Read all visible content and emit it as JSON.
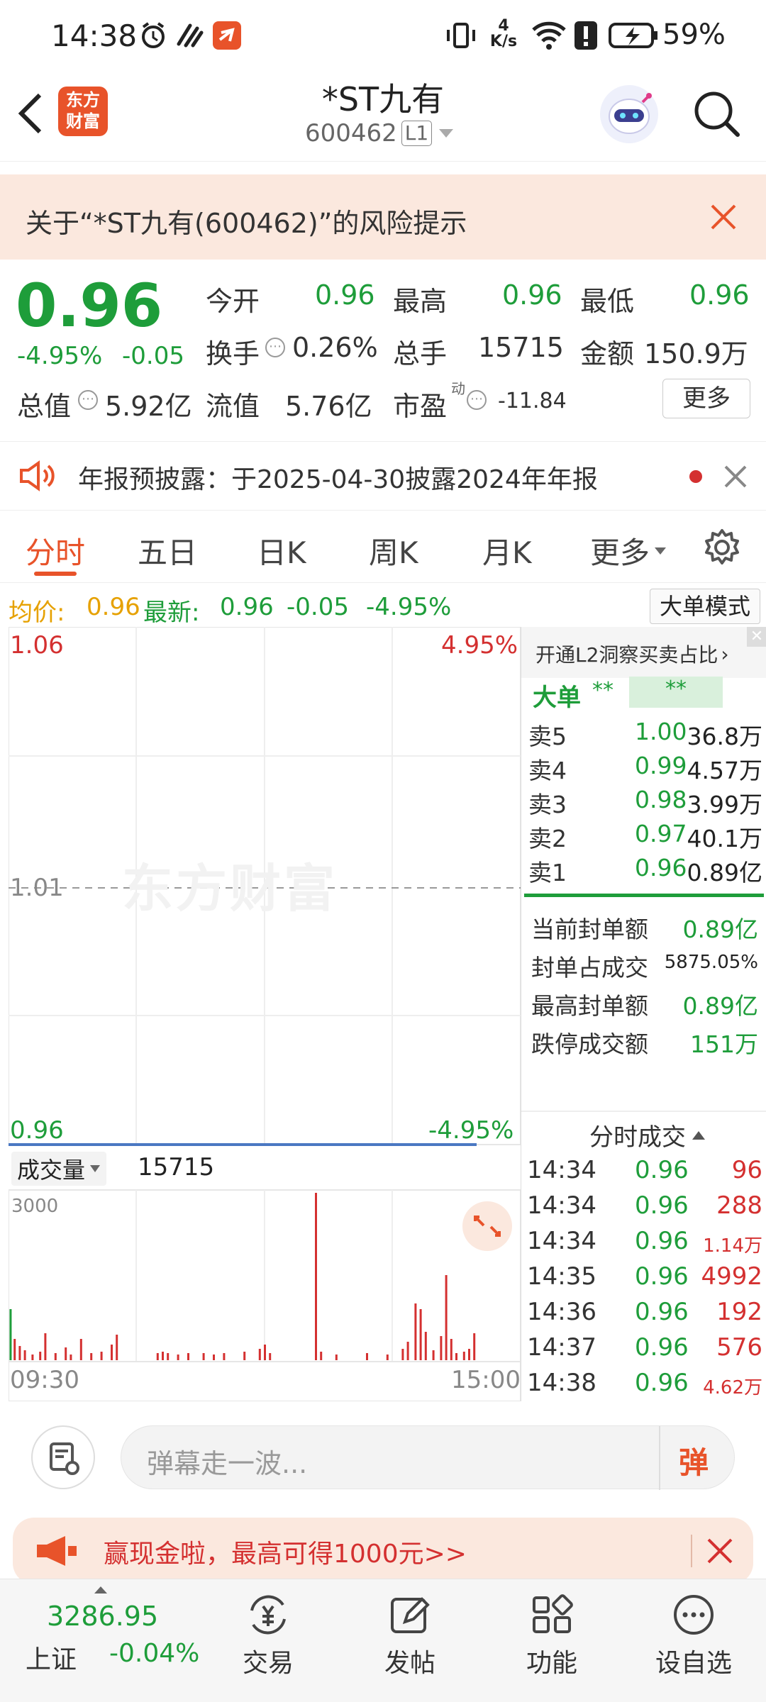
{
  "status": {
    "time": "14:38",
    "net_speed_top": "4",
    "net_speed_bottom": "K/s",
    "battery": "59%"
  },
  "header": {
    "title": "*ST九有",
    "code": "600462",
    "level": "L1",
    "logo_line1": "东方",
    "logo_line2": "财富"
  },
  "risk_banner": {
    "text": "关于“*ST九有(600462)”的风险提示"
  },
  "quote": {
    "price": "0.96",
    "change_pct": "-4.95%",
    "change": "-0.05",
    "open_label": "今开",
    "open": "0.96",
    "high_label": "最高",
    "high": "0.96",
    "low_label": "最低",
    "low": "0.96",
    "turnover_label": "换手",
    "turnover": "0.26%",
    "volume_label": "总手",
    "volume": "15715",
    "amount_label": "金额",
    "amount": "150.9万",
    "mcap_label": "总值",
    "mcap": "5.92亿",
    "float_label": "流值",
    "float": "5.76亿",
    "pe_label": "市盈",
    "pe_sup": "动",
    "pe": "-11.84",
    "more": "更多"
  },
  "notice": {
    "text": "年报预披露：于2025-04-30披露2024年年报"
  },
  "tabs": [
    "分时",
    "五日",
    "日K",
    "周K",
    "月K",
    "更多"
  ],
  "infoline": {
    "avg_label": "均价:",
    "avg": "0.96",
    "last_label": "最新:",
    "last": "0.96",
    "chg": "-0.05",
    "pct": "-4.95%",
    "mode_btn": "大单模式"
  },
  "chart": {
    "y_top": "1.06",
    "y_top_pct": "4.95%",
    "y_mid": "1.01",
    "y_bot": "0.96",
    "y_bot_pct": "-4.95%",
    "watermark": "东方财富",
    "volume_label": "成交量",
    "volume_value": "15715",
    "vol_axis": "3000",
    "t_start": "09:30",
    "t_end": "15:00"
  },
  "chart_data": {
    "type": "bar",
    "title": "",
    "xlabel": "",
    "ylabel": "",
    "x_range": [
      "09:30",
      "15:00"
    ],
    "ylim": [
      0,
      3000
    ]
  },
  "rpanel": {
    "l2_link": "开通L2洞察买卖占比",
    "big_label": "大单",
    "big_v1": "**",
    "big_v2": "**",
    "asks": [
      {
        "label": "卖5",
        "price": "1.00",
        "vol": "36.8万"
      },
      {
        "label": "卖4",
        "price": "0.99",
        "vol": "4.57万"
      },
      {
        "label": "卖3",
        "price": "0.98",
        "vol": "3.99万"
      },
      {
        "label": "卖2",
        "price": "0.97",
        "vol": "40.1万"
      },
      {
        "label": "卖1",
        "price": "0.96",
        "vol": "0.89亿"
      }
    ],
    "seal": [
      {
        "label": "当前封单额",
        "value": "0.89亿"
      },
      {
        "label": "封单占成交",
        "value": "5875.05%"
      },
      {
        "label": "最高封单额",
        "value": "0.89亿"
      },
      {
        "label": "跌停成交额",
        "value": "151万"
      }
    ],
    "ticks_title": "分时成交",
    "ticks": [
      {
        "t": "14:34",
        "p": "0.96",
        "v": "96"
      },
      {
        "t": "14:34",
        "p": "0.96",
        "v": "288"
      },
      {
        "t": "14:34",
        "p": "0.96",
        "v": "1.14万"
      },
      {
        "t": "14:35",
        "p": "0.96",
        "v": "4992"
      },
      {
        "t": "14:36",
        "p": "0.96",
        "v": "192"
      },
      {
        "t": "14:37",
        "p": "0.96",
        "v": "576"
      },
      {
        "t": "14:38",
        "p": "0.96",
        "v": "4.62万"
      }
    ]
  },
  "danmu": {
    "placeholder": "弹幕走一波...",
    "send": "弹"
  },
  "promo": {
    "text": "赢现金啦，最高可得1000元>>"
  },
  "botnav": {
    "index_value": "3286.95",
    "index_name": "上证",
    "index_pct": "-0.04%",
    "trade": "交易",
    "post": "发帖",
    "func": "功能",
    "watch": "设自选"
  }
}
